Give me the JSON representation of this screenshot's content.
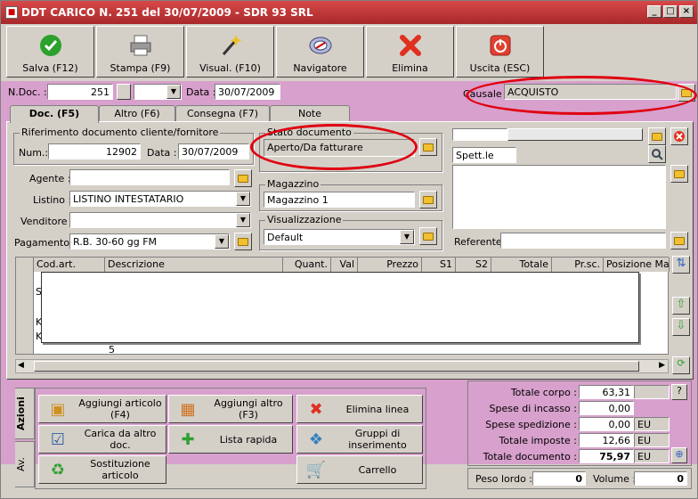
{
  "window": {
    "title": "DDT CARICO N. 251  del 30/07/2009 - SDR 93 SRL",
    "min": "_",
    "max": "□",
    "close": "×"
  },
  "toolbar": [
    {
      "label": "Salva (F12)",
      "icon": "check-icon"
    },
    {
      "label": "Stampa (F9)",
      "icon": "printer-icon"
    },
    {
      "label": "Visual. (F10)",
      "icon": "magic-wand-icon"
    },
    {
      "label": "Navigatore",
      "icon": "compass-icon"
    },
    {
      "label": "Elimina",
      "icon": "delete-x-icon"
    },
    {
      "label": "Uscita (ESC)",
      "icon": "power-icon"
    }
  ],
  "header": {
    "ndoc_label": "N.Doc. :",
    "ndoc_value": "251",
    "data_label": "Data :",
    "data_value": "30/07/2009",
    "causale_label": "Causale :",
    "causale_value": "ACQUISTO"
  },
  "tabs": [
    "Doc. (F5)",
    "Altro (F6)",
    "Consegna (F7)",
    "Note"
  ],
  "riferimento": {
    "title": "Riferimento documento cliente/fornitore",
    "num_label": "Num.:",
    "num_value": "12902",
    "data_label": "Data :",
    "data_value": "30/07/2009"
  },
  "fields": {
    "agente_label": "Agente :",
    "agente_value": "",
    "listino_label": "Listino :",
    "listino_value": "LISTINO INTESTATARIO",
    "venditore_label": "Venditore :",
    "venditore_value": "",
    "pagamento_label": "Pagamento :",
    "pagamento_value": "R.B. 30-60 gg FM"
  },
  "stato": {
    "title": "Stato documento",
    "value": "Aperto/Da fatturare"
  },
  "magazzino": {
    "title": "Magazzino",
    "value": "Magazzino 1"
  },
  "visualizzazione": {
    "title": "Visualizzazione",
    "value": "Default"
  },
  "intestatario": {
    "spett": "Spett.le",
    "referente_label": "Referente"
  },
  "grid": {
    "columns": [
      "Cod.art.",
      "Descrizione",
      "Quant.",
      "Val",
      "Prezzo",
      "S1",
      "S2",
      "Totale",
      "Pr.sc.",
      "Posizione Mag"
    ],
    "row_text": "5",
    "left_letters": [
      "S",
      "K",
      "K"
    ]
  },
  "azioni": {
    "tab_label": "Azioni",
    "tab2_label": "Av.",
    "buttons": [
      {
        "label": "Aggiungi articolo (F4)",
        "icon": "add-box-icon"
      },
      {
        "label": "Aggiungi altro (F3)",
        "icon": "add-grid-icon"
      },
      {
        "label": "Elimina linea",
        "icon": "delete-x-icon"
      },
      {
        "label": "Carica da altro doc.",
        "icon": "load-doc-icon"
      },
      {
        "label": "Lista rapida",
        "icon": "quick-list-icon"
      },
      {
        "label": "Gruppi di inserimento",
        "icon": "group-insert-icon"
      },
      {
        "label": "Sostituzione articolo",
        "icon": "replace-icon"
      },
      {
        "label": "Carrello",
        "icon": "cart-icon"
      }
    ]
  },
  "totali": {
    "corpo_label": "Totale corpo :",
    "corpo_value": "63,31",
    "incasso_label": "Spese di incasso :",
    "incasso_value": "0,00",
    "spedizione_label": "Spese spedizione :",
    "spedizione_value": "0,00",
    "spedizione_unit": "EU",
    "imposte_label": "Totale imposte :",
    "imposte_value": "12,66",
    "imposte_unit": "EU",
    "documento_label": "Totale documento :",
    "documento_value": "75,97",
    "documento_unit": "EU",
    "help": "?",
    "peso_label": "Peso lordo :",
    "peso_value": "0",
    "volume_label": "Volume :",
    "volume_value": "0"
  },
  "colors": {
    "title": "#b8302e",
    "pink": "#d8a0cc",
    "highlight": "#e00010"
  }
}
